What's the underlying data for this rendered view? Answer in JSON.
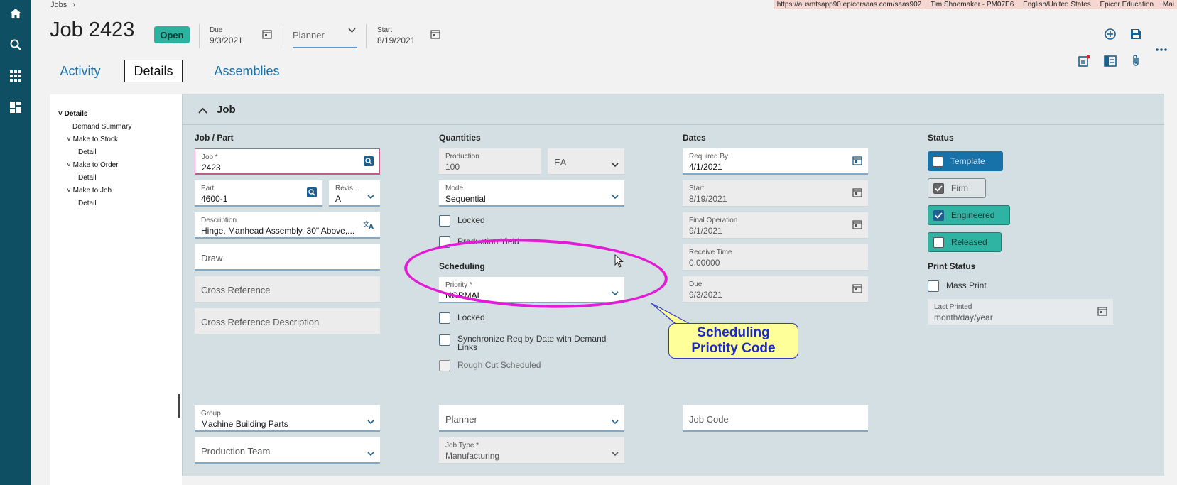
{
  "topbar": {
    "url": "https://ausmtsapp90.epicorsaas.com/saas902",
    "user": "Tim Shoemaker - PM07E6",
    "locale": "English/United States",
    "company": "Epicor Education",
    "extra": "Mai"
  },
  "breadcrumb": {
    "label": "Jobs",
    "sep": "›"
  },
  "header": {
    "title": "Job 2423",
    "status_badge": "Open",
    "due_label": "Due",
    "due_value": "9/3/2021",
    "planner_placeholder": "Planner",
    "start_label": "Start",
    "start_value": "8/19/2021"
  },
  "tabs": [
    "Activity",
    "Details",
    "Assemblies"
  ],
  "tree": {
    "root": "Details",
    "demand_summary": "Demand Summary",
    "make_to_stock": "Make to Stock",
    "make_to_order": "Make to Order",
    "make_to_job": "Make to Job",
    "detail": "Detail"
  },
  "panel": {
    "title": "Job"
  },
  "job_part": {
    "heading": "Job / Part",
    "job_label": "Job *",
    "job_value": "2423",
    "part_label": "Part",
    "part_value": "4600-1",
    "revision_label": "Revis...",
    "revision_value": "A",
    "description_label": "Description",
    "description_value": "Hinge, Manhead Assembly, 30\" Above,...",
    "draw_placeholder": "Draw",
    "cross_reference_placeholder": "Cross Reference",
    "cross_reference_desc_placeholder": "Cross Reference Description",
    "group_label": "Group",
    "group_value": "Machine Building Parts",
    "production_team_placeholder": "Production Team"
  },
  "quantities": {
    "heading": "Quantities",
    "production_label": "Production",
    "production_value": "100",
    "uom_value": "EA",
    "mode_label": "Mode",
    "mode_value": "Sequential",
    "locked_label": "Locked",
    "production_yield_label": "Production Yield"
  },
  "scheduling": {
    "heading": "Scheduling",
    "priority_label": "Priority *",
    "priority_value": "NORMAL",
    "locked_label": "Locked",
    "sync_label": "Synchronize Req by Date with Demand Links",
    "rough_cut_label": "Rough Cut Scheduled",
    "planner_placeholder": "Planner",
    "job_type_label": "Job Type *",
    "job_type_value": "Manufacturing"
  },
  "dates": {
    "heading": "Dates",
    "required_by_label": "Required By",
    "required_by_value": "4/1/2021",
    "start_label": "Start",
    "start_value": "8/19/2021",
    "final_operation_label": "Final Operation",
    "final_operation_value": "9/1/2021",
    "receive_time_label": "Receive Time",
    "receive_time_value": "0.00000",
    "due_label": "Due",
    "due_value": "9/3/2021",
    "job_code_placeholder": "Job Code"
  },
  "status": {
    "heading": "Status",
    "template_label": "Template",
    "firm_label": "Firm",
    "engineered_label": "Engineered",
    "released_label": "Released",
    "print_heading": "Print Status",
    "mass_print_label": "Mass Print",
    "last_printed_label": "Last Printed",
    "last_printed_value": "month/day/year"
  },
  "annotation": {
    "callout_line1": "Scheduling",
    "callout_line2": "Priotity Code"
  },
  "colors": {
    "rail": "#0f4f63",
    "open_badge": "#2cb3a0",
    "template_bg": "#1672a8",
    "engineered_bg": "#2fb3a3",
    "highlight_ellipse": "#e31ad6",
    "callout_bg": "#ffff99",
    "callout_text": "#1c2ac4"
  }
}
